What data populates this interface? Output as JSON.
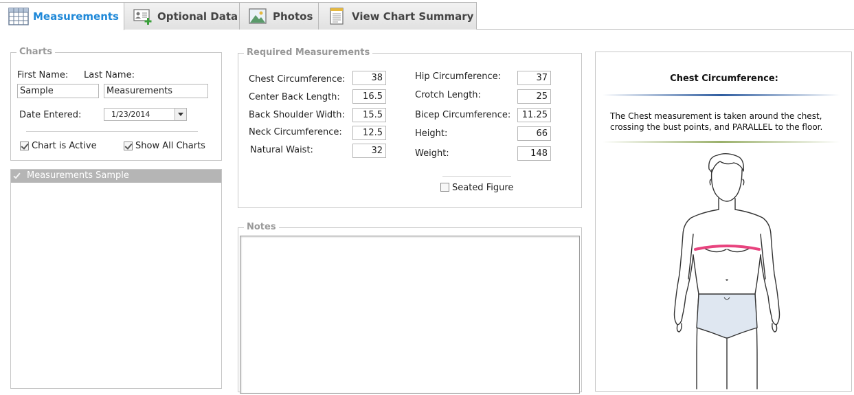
{
  "tabs": [
    {
      "label": "Measurements",
      "icon": "table-icon",
      "active": true
    },
    {
      "label": "Optional Data",
      "icon": "contact-card-add-icon",
      "active": false
    },
    {
      "label": "Photos",
      "icon": "photo-icon",
      "active": false
    },
    {
      "label": "View Chart Summary",
      "icon": "document-icon",
      "active": false
    }
  ],
  "charts": {
    "legend": "Charts",
    "first_name_label": "First Name:",
    "last_name_label": "Last Name:",
    "first_name_value": "Sample",
    "last_name_value": "Measurements",
    "date_label": "Date Entered:",
    "date_value": "1/23/2014",
    "chart_active_label": "Chart is Active",
    "show_all_label": "Show All Charts",
    "chart_active_checked": true,
    "show_all_checked": true
  },
  "chart_list": {
    "items": [
      "Measurements Sample"
    ]
  },
  "required": {
    "legend": "Required Measurements",
    "left": [
      {
        "label": "Chest Circumference:",
        "value": "38"
      },
      {
        "label": "Center Back Length:",
        "value": "16.5"
      },
      {
        "label": "Back Shoulder Width:",
        "value": "15.5"
      },
      {
        "label": "Neck Circumference:",
        "value": "12.5"
      },
      {
        "label": "Natural Waist:",
        "value": "32"
      }
    ],
    "right": [
      {
        "label": "Hip Circumference:",
        "value": "37"
      },
      {
        "label": "Crotch Length:",
        "value": "25"
      },
      {
        "label": "Bicep Circumference:",
        "value": "11.25"
      },
      {
        "label": "Height:",
        "value": "66"
      },
      {
        "label": "Weight:",
        "value": "148"
      }
    ],
    "seated_label": "Seated Figure",
    "seated_checked": false
  },
  "notes": {
    "legend": "Notes",
    "value": ""
  },
  "help": {
    "title": "Chest Circumference:",
    "description": "The Chest measurement is taken around the chest, crossing the bust points, and PARALLEL to the floor.",
    "highlight_color": "#e8437e"
  },
  "colors": {
    "active_tab": "#1e88d8",
    "legend": "#999999"
  }
}
